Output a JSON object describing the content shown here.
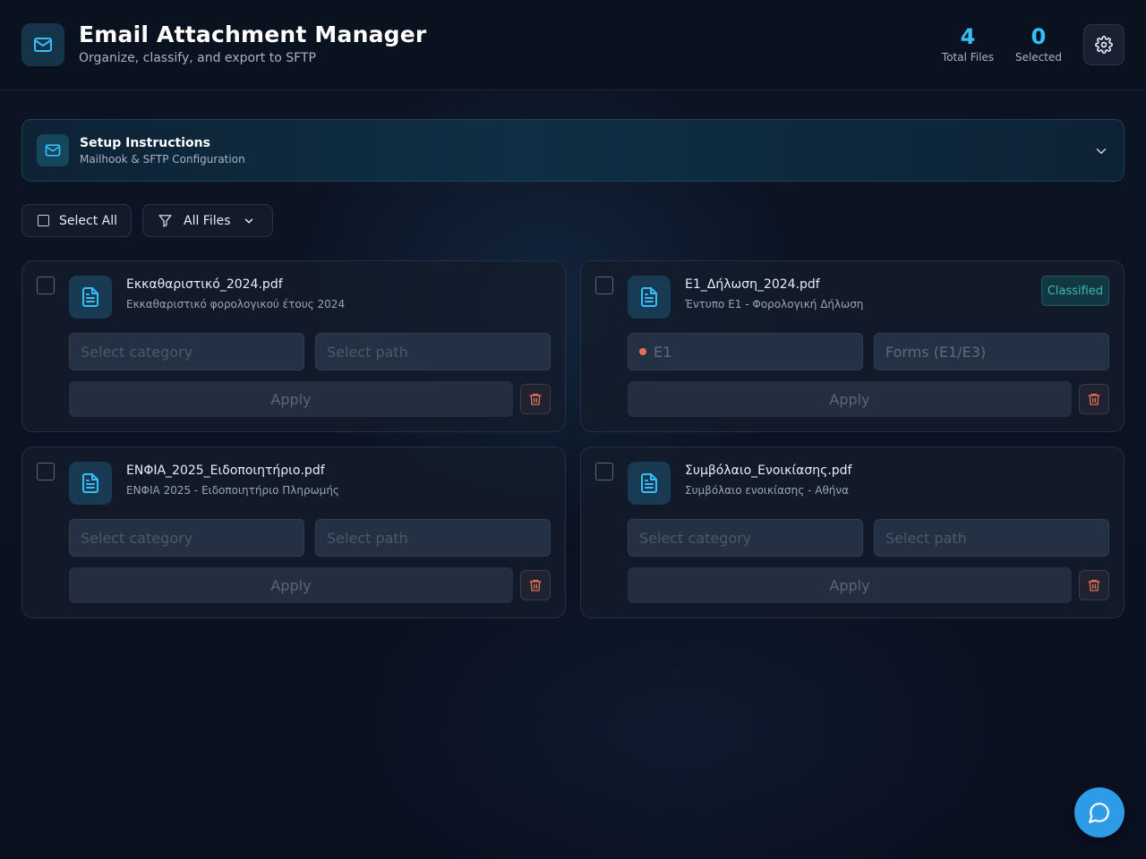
{
  "header": {
    "title": "Email Attachment Manager",
    "subtitle": "Organize, classify, and export to SFTP",
    "logo_icon": "mail-icon",
    "stats": {
      "total_files_value": "4",
      "total_files_label": "Total Files",
      "selected_value": "0",
      "selected_label": "Selected"
    },
    "settings_icon": "gear-icon"
  },
  "setup": {
    "title": "Setup Instructions",
    "subtitle": "Mailhook & SFTP Configuration",
    "icon": "mail-icon",
    "expand_icon": "chevron-down-icon"
  },
  "toolbar": {
    "select_all_label": "Select All",
    "filter_label": "All Files",
    "filter_icon": "filter-icon"
  },
  "files": [
    {
      "name": "Εκκαθαριστικό_2024.pdf",
      "description": "Εκκαθαριστικό φορολογικού έτους 2024",
      "category": "Select category",
      "path": "Select path",
      "apply_label": "Apply",
      "classified": false
    },
    {
      "name": "Ε1_Δήλωση_2024.pdf",
      "description": "Έντυπο Ε1 - Φορολογική Δήλωση",
      "category": "Ε1",
      "path": "Forms (E1/E3)",
      "apply_label": "Apply",
      "classified": true,
      "badge": "Classified"
    },
    {
      "name": "ΕΝΦΙΑ_2025_Ειδοποιητήριο.pdf",
      "description": "ΕΝΦΙΑ 2025 - Ειδοποιητήριο Πληρωμής",
      "category": "Select category",
      "path": "Select path",
      "apply_label": "Apply",
      "classified": false
    },
    {
      "name": "Συμβόλαιο_Ενοικίασης.pdf",
      "description": "Συμβόλαιο ενοικίασης - Αθήνα",
      "category": "Select category",
      "path": "Select path",
      "apply_label": "Apply",
      "classified": false
    }
  ],
  "colors": {
    "accent": "#38bdf8",
    "classified_badge": "#3fb6b0",
    "category_dot": "#e0735a",
    "delete_icon": "#e0735a",
    "chat_fab": "#2d9be6"
  },
  "chat_icon": "chat-bubble-icon"
}
